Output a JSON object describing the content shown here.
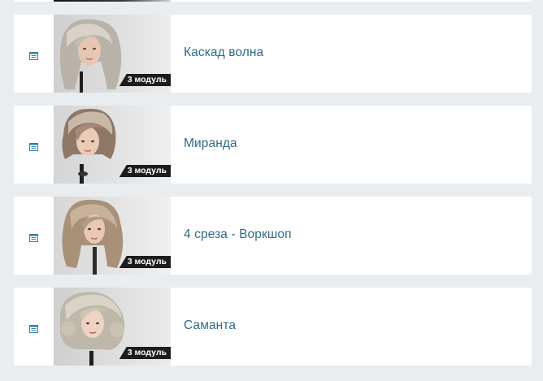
{
  "lessons": [
    {
      "title": "Каскад волна",
      "badge": "3 модуль",
      "thumbnail": "mannequin-blonde-wavy-hair",
      "icon": "document-icon"
    },
    {
      "title": "Миранда",
      "badge": "3 модуль",
      "thumbnail": "mannequin-short-shag-hair",
      "icon": "document-icon"
    },
    {
      "title": "4 среза - Воркшоп",
      "badge": "3 модуль",
      "thumbnail": "mannequin-long-layered-hair",
      "icon": "document-icon"
    },
    {
      "title": "Саманта",
      "badge": "3 модуль",
      "thumbnail": "mannequin-curly-bob-hair",
      "icon": "document-icon"
    }
  ],
  "colors": {
    "page_bg": "#e9edf0",
    "card_bg": "#ffffff",
    "title_text": "#2d6c86",
    "icon": "#2f7fa6",
    "badge_bg": "#1c1c1c",
    "badge_text": "#ffffff"
  }
}
